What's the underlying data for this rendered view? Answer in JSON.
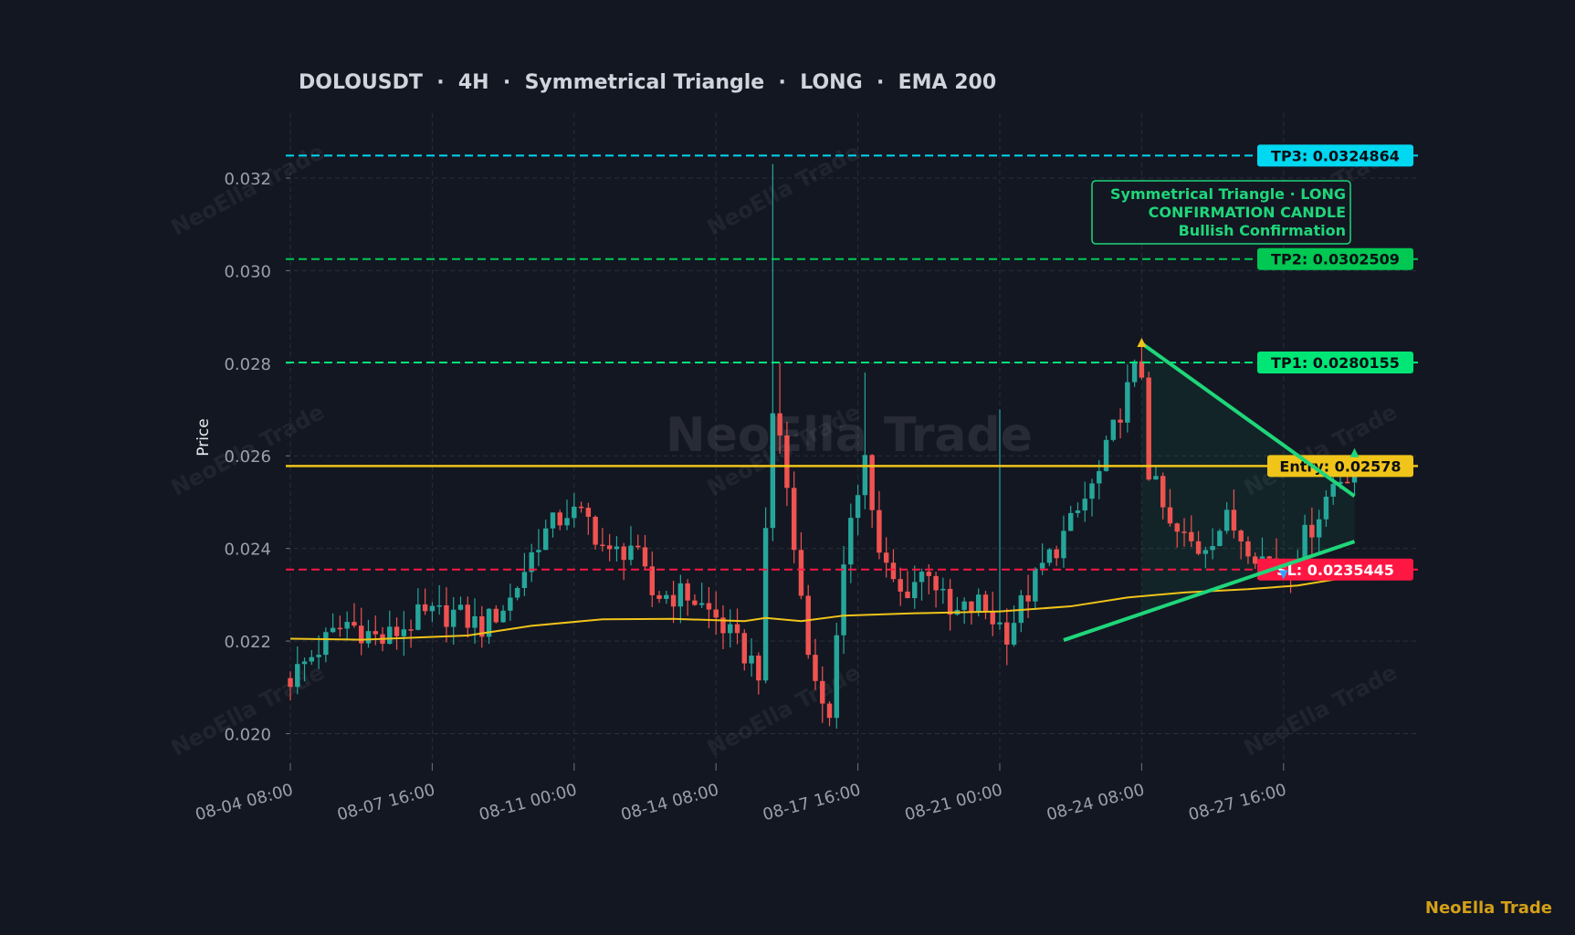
{
  "title": "DOLOUSDT  ·  4H  ·  Symmetrical Triangle  ·  LONG  ·  EMA 200",
  "brand": "NeoElla Trade",
  "watermark": "NeoElla Trade",
  "colors": {
    "background": "#131722",
    "grid": "#2a2e39",
    "up": "#26a69a",
    "down": "#ef5350",
    "ema": "#f0c419",
    "entry": "#f0c419",
    "tp1": "#00e676",
    "tp2": "#00c853",
    "tp3": "#00d7f0",
    "sl": "#ff1744",
    "trendline": "#1fd67a",
    "text": "#9aa0ab"
  },
  "chart_data": {
    "type": "candlestick",
    "title": "DOLOUSDT  ·  4H  ·  Symmetrical Triangle  ·  LONG  ·  EMA 200",
    "xlabel": "",
    "ylabel": "Price",
    "ylim": [
      0.0193,
      0.0334
    ],
    "yticks": [
      "0.020",
      "0.022",
      "0.024",
      "0.026",
      "0.028",
      "0.030",
      "0.032"
    ],
    "ytick_values": [
      0.02,
      0.022,
      0.024,
      0.026,
      0.028,
      0.03,
      0.032
    ],
    "x_start": "2025-08-04 08:00",
    "x_end": "2025-08-29 08:00",
    "xtick_labels": [
      "08-04 08:00",
      "08-07 16:00",
      "08-11 00:00",
      "08-14 08:00",
      "08-17 16:00",
      "08-21 00:00",
      "08-24 08:00",
      "08-27 16:00"
    ],
    "xtick_dates": [
      "2025-08-04 08:00",
      "2025-08-07 16:00",
      "2025-08-11 00:00",
      "2025-08-14 08:00",
      "2025-08-17 16:00",
      "2025-08-21 00:00",
      "2025-08-24 08:00",
      "2025-08-27 16:00"
    ],
    "grid": true,
    "close_anchors": [
      [
        "2025-08-04 08:00",
        0.0212
      ],
      [
        "2025-08-05 04:00",
        0.022
      ],
      [
        "2025-08-05 16:00",
        0.0224
      ],
      [
        "2025-08-06 12:00",
        0.022
      ],
      [
        "2025-08-07 08:00",
        0.0225
      ],
      [
        "2025-08-08 04:00",
        0.0226
      ],
      [
        "2025-08-08 20:00",
        0.0223
      ],
      [
        "2025-08-09 12:00",
        0.0229
      ],
      [
        "2025-08-10 04:00",
        0.0242
      ],
      [
        "2025-08-10 20:00",
        0.0248
      ],
      [
        "2025-08-11 08:00",
        0.0246
      ],
      [
        "2025-08-11 20:00",
        0.0238
      ],
      [
        "2025-08-12 08:00",
        0.0241
      ],
      [
        "2025-08-12 20:00",
        0.023
      ],
      [
        "2025-08-13 16:00",
        0.023
      ],
      [
        "2025-08-14 08:00",
        0.0225
      ],
      [
        "2025-08-14 20:00",
        0.0219
      ],
      [
        "2025-08-15 08:00",
        0.0214
      ],
      [
        "2025-08-15 16:00",
        0.0269
      ],
      [
        "2025-08-15 20:00",
        0.0265
      ],
      [
        "2025-08-16 04:00",
        0.024
      ],
      [
        "2025-08-16 16:00",
        0.021
      ],
      [
        "2025-08-17 00:00",
        0.0205
      ],
      [
        "2025-08-17 12:00",
        0.0248
      ],
      [
        "2025-08-17 20:00",
        0.026
      ],
      [
        "2025-08-18 04:00",
        0.0238
      ],
      [
        "2025-08-18 16:00",
        0.023
      ],
      [
        "2025-08-19 08:00",
        0.0236
      ],
      [
        "2025-08-19 20:00",
        0.0225
      ],
      [
        "2025-08-20 12:00",
        0.0228
      ],
      [
        "2025-08-21 04:00",
        0.0222
      ],
      [
        "2025-08-22 00:00",
        0.0236
      ],
      [
        "2025-08-22 16:00",
        0.0245
      ],
      [
        "2025-08-23 08:00",
        0.0256
      ],
      [
        "2025-08-23 20:00",
        0.027
      ],
      [
        "2025-08-24 04:00",
        0.0278
      ],
      [
        "2025-08-24 08:00",
        0.0278
      ],
      [
        "2025-08-24 12:00",
        0.0257
      ],
      [
        "2025-08-25 00:00",
        0.0244
      ],
      [
        "2025-08-25 16:00",
        0.024
      ],
      [
        "2025-08-26 08:00",
        0.0246
      ],
      [
        "2025-08-27 04:00",
        0.0238
      ],
      [
        "2025-08-27 20:00",
        0.0237
      ],
      [
        "2025-08-28 08:00",
        0.0245
      ],
      [
        "2025-08-28 20:00",
        0.0254
      ],
      [
        "2025-08-29 08:00",
        0.0258
      ]
    ],
    "ema": [
      [
        "2025-08-04 08:00",
        0.02205
      ],
      [
        "2025-08-06 00:00",
        0.02203
      ],
      [
        "2025-08-08 12:00",
        0.02212
      ],
      [
        "2025-08-10 00:00",
        0.02233
      ],
      [
        "2025-08-11 16:00",
        0.02247
      ],
      [
        "2025-08-13 08:00",
        0.02248
      ],
      [
        "2025-08-15 00:00",
        0.02243
      ],
      [
        "2025-08-15 12:00",
        0.0225
      ],
      [
        "2025-08-16 08:00",
        0.02243
      ],
      [
        "2025-08-17 08:00",
        0.02255
      ],
      [
        "2025-08-19 00:00",
        0.0226
      ],
      [
        "2025-08-21 00:00",
        0.02264
      ],
      [
        "2025-08-22 16:00",
        0.02275
      ],
      [
        "2025-08-24 00:00",
        0.02294
      ],
      [
        "2025-08-25 08:00",
        0.02305
      ],
      [
        "2025-08-26 20:00",
        0.02312
      ],
      [
        "2025-08-28 00:00",
        0.0232
      ],
      [
        "2025-08-29 08:00",
        0.0234
      ]
    ],
    "levels": [
      {
        "name": "TP3",
        "label": "TP3: 0.0324864",
        "value": 0.0324864,
        "style": "dashed",
        "color": "#00d7f0"
      },
      {
        "name": "TP2",
        "label": "TP2: 0.0302509",
        "value": 0.0302509,
        "style": "dashed",
        "color": "#00c853"
      },
      {
        "name": "TP1",
        "label": "TP1: 0.0280155",
        "value": 0.0280155,
        "style": "dashed",
        "color": "#00e676"
      },
      {
        "name": "Entry",
        "label": "Entry: 0.02578",
        "value": 0.02578,
        "style": "solid",
        "color": "#f0c419"
      },
      {
        "name": "SL",
        "label": "SL: 0.0235445",
        "value": 0.0235445,
        "style": "dashed",
        "color": "#ff1744"
      }
    ],
    "trendlines": [
      {
        "name": "upper",
        "from": [
          "2025-08-24 08:00",
          0.02843
        ],
        "to": [
          "2025-08-29 08:00",
          0.02513
        ]
      },
      {
        "name": "lower",
        "from": [
          "2025-08-22 12:00",
          0.02202
        ],
        "to": [
          "2025-08-29 08:00",
          0.02415
        ]
      }
    ],
    "annotation": {
      "lines": [
        "Symmetrical Triangle · LONG",
        "CONFIRMATION CANDLE",
        "Bullish Confirmation"
      ],
      "position": "top-right",
      "color": "#1fd67a"
    },
    "markers": [
      {
        "kind": "pivot-high",
        "shape": "triangle-up",
        "at": [
          "2025-08-24 08:00",
          0.02843
        ],
        "color": "#f0c419"
      },
      {
        "kind": "pivot-low",
        "shape": "triangle-down",
        "at": [
          "2025-08-27 16:00",
          0.02345
        ],
        "color": "#3aa0ff"
      },
      {
        "kind": "signal",
        "shape": "triangle-up",
        "at": [
          "2025-08-29 08:00",
          0.02605
        ],
        "color": "#1fd67a"
      }
    ]
  }
}
